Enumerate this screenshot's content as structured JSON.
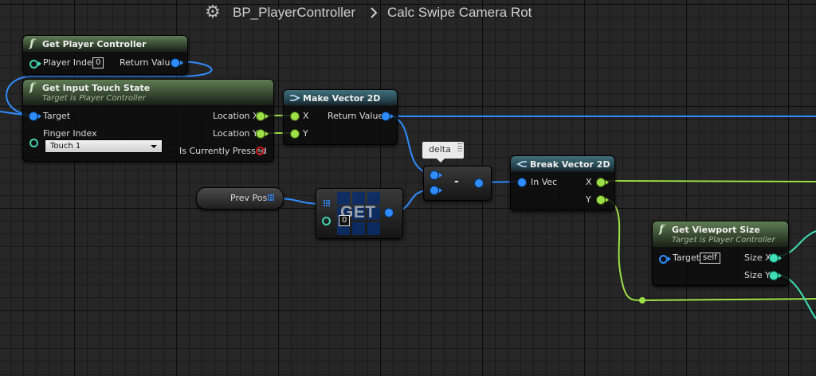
{
  "breadcrumb": {
    "icon": "gear-icon",
    "blueprint": "BP_PlayerController",
    "function": "Calc Swipe Camera Rot"
  },
  "nodes": {
    "get_player_controller": {
      "title": "Get Player Controller",
      "player_index_label": "Player Index",
      "player_index_value": "0",
      "return_value_label": "Return Value"
    },
    "get_input_touch_state": {
      "title": "Get Input Touch State",
      "subtitle": "Target is Player Controller",
      "target_label": "Target",
      "finger_index_label": "Finger Index",
      "finger_index_value": "Touch 1",
      "location_x_label": "Location X",
      "location_y_label": "Location Y",
      "is_pressed_label": "Is Currently Pressed"
    },
    "make_vector_2d": {
      "title": "Make Vector 2D",
      "x_label": "X",
      "y_label": "Y",
      "return_value_label": "Return Value"
    },
    "subtract": {
      "comment": "delta",
      "operator": "-"
    },
    "break_vector_2d": {
      "title": "Break Vector 2D",
      "in_vec_label": "In Vec",
      "x_label": "X",
      "y_label": "Y"
    },
    "prev_pos": {
      "label": "Prev Pos"
    },
    "get_array": {
      "label": "GET",
      "index_value": "0"
    },
    "get_viewport_size": {
      "title": "Get Viewport Size",
      "subtitle": "Target is Player Controller",
      "target_label": "Target",
      "target_value": "self",
      "size_x_label": "Size X",
      "size_y_label": "Size Y"
    }
  },
  "colors": {
    "background": "#262626",
    "vector_wire": "#2f8cff",
    "float_wire": "#9ee047",
    "int_wire": "#3fe0b8",
    "bool_pin": "#c21818",
    "function_header": "#5f7d55",
    "pure_header": "#3f6f7a"
  }
}
